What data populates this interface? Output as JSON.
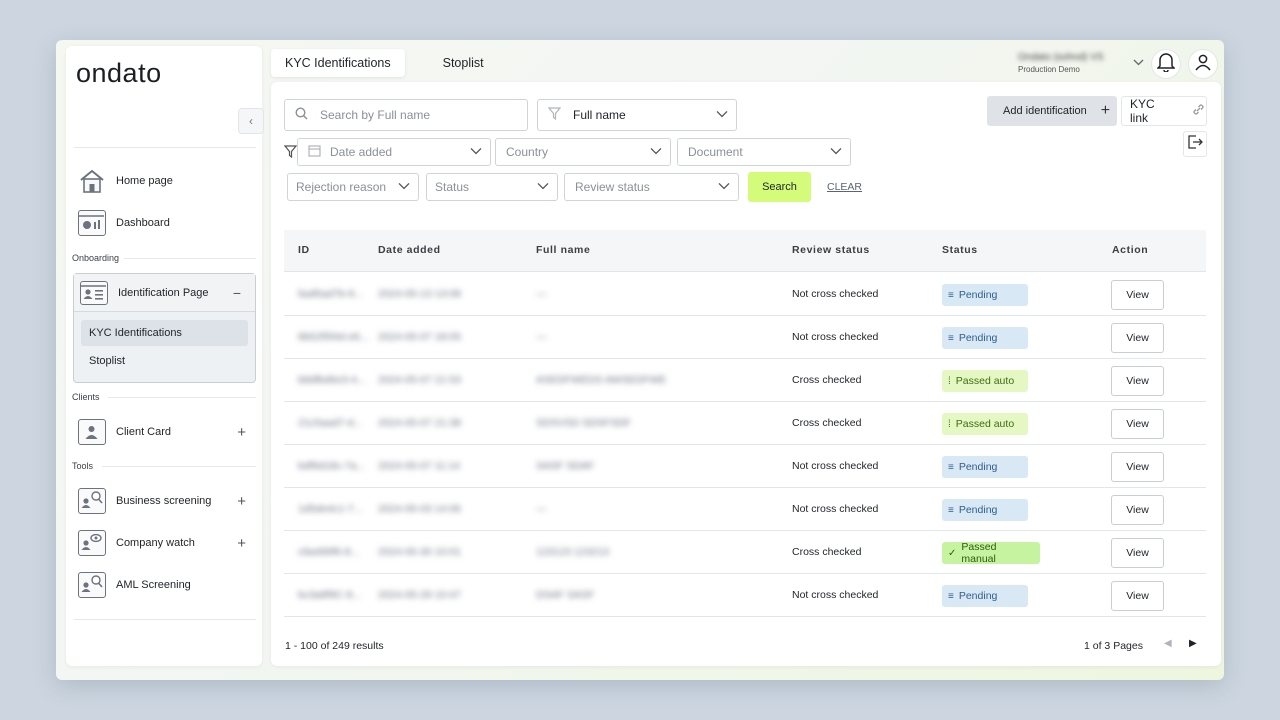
{
  "brand": {
    "logo_text": "ondato"
  },
  "sidebar": {
    "collapse_label": "‹",
    "items": [
      {
        "label": "Home page"
      },
      {
        "label": "Dashboard"
      }
    ],
    "onboarding_label": "Onboarding",
    "identification": {
      "label": "Identification Page",
      "toggle": "−",
      "children": [
        {
          "label": "KYC Identifications"
        },
        {
          "label": "Stoplist"
        }
      ]
    },
    "clients_label": "Clients",
    "client_card": {
      "label": "Client Card",
      "plus": "+"
    },
    "tools_label": "Tools",
    "tools": [
      {
        "label": "Business screening",
        "plus": "+"
      },
      {
        "label": "Company watch",
        "plus": "+"
      },
      {
        "label": "AML Screening",
        "plus": ""
      }
    ]
  },
  "tabs": [
    {
      "label": "KYC Identifications"
    },
    {
      "label": "Stoplist"
    }
  ],
  "account": {
    "name": "Ondato (sohnd) VS",
    "env": "Production Demo"
  },
  "actions": {
    "add_label": "Add identification",
    "add_plus": "+",
    "kyc_link_label": "KYC link"
  },
  "filters": {
    "search_placeholder": "Search by Full name",
    "search_by": "Full name",
    "date_added": "Date added",
    "country": "Country",
    "document": "Document",
    "rejection_reason": "Rejection reason",
    "status": "Status",
    "review_status": "Review status",
    "search_button": "Search",
    "clear_link": "CLEAR"
  },
  "table": {
    "columns": [
      "ID",
      "Date added",
      "Full name",
      "Review status",
      "Status",
      "Action"
    ],
    "rows": [
      {
        "id": "faaf6ad7b-9...",
        "date": "2024-05-13 13:08",
        "name": "—",
        "review": "Not cross checked",
        "status": "Pending",
        "status_type": "pending",
        "action": "View"
      },
      {
        "id": "8b52f5f4d-e6...",
        "date": "2024-05-07 18:05",
        "name": "—",
        "review": "Not cross checked",
        "status": "Pending",
        "status_type": "pending",
        "action": "View"
      },
      {
        "id": "b8dfbd6e3-4...",
        "date": "2024-05-07 21:53",
        "name": "ASEDFWEDS AWSEDFWE",
        "review": "Cross checked",
        "status": "Passed auto",
        "status_type": "passed-auto",
        "action": "View"
      },
      {
        "id": "21c5aad7-d...",
        "date": "2024-05-07 21:38",
        "name": "SDSVSD SDSFSDF",
        "review": "Cross checked",
        "status": "Passed auto",
        "status_type": "passed-auto",
        "action": "View"
      },
      {
        "id": "bdf6d18c-7a...",
        "date": "2024-05-07 11:14",
        "name": "SASF SDAF",
        "review": "Not cross checked",
        "status": "Pending",
        "status_type": "pending",
        "action": "View"
      },
      {
        "id": "1d5de4c1-7...",
        "date": "2024-05-03 14:06",
        "name": "—",
        "review": "Not cross checked",
        "status": "Pending",
        "status_type": "pending",
        "action": "View"
      },
      {
        "id": "c9a489f6-8...",
        "date": "2024-05-30 10:01",
        "name": "123123 123213",
        "review": "Cross checked",
        "status": "Passed manual",
        "status_type": "passed-manual",
        "action": "View"
      },
      {
        "id": "bc3a8f9C-9...",
        "date": "2024-05-29 10:47",
        "name": "DSAF SASF",
        "review": "Not cross checked",
        "status": "Pending",
        "status_type": "pending",
        "action": "View"
      }
    ]
  },
  "pagination": {
    "results": "1 - 100 of 249 results",
    "pages": "1 of 3 Pages",
    "prev": "◀",
    "next": "▶"
  },
  "colors": {
    "accent_green": "#d4fb7a",
    "pending_bg": "#d9e8f5",
    "passed_auto_bg": "#e5f8c3",
    "passed_manual_bg": "#c6f3a0"
  }
}
